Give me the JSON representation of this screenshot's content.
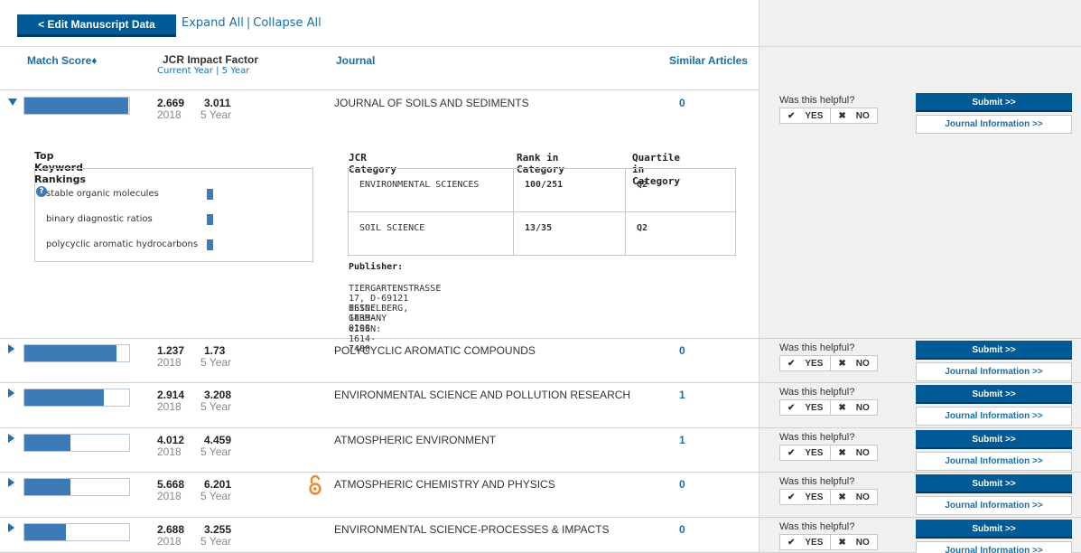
{
  "toolbar": {
    "edit_label": "< Edit Manuscript Data",
    "expand_all": "Expand All",
    "separator": "|",
    "collapse_all": "Collapse All"
  },
  "columns": {
    "match_score": "Match Score♦",
    "jcr_title": "JCR Impact Factor",
    "jcr_current": "Current Year",
    "jcr_sep": "|",
    "jcr_5year": "5 Year",
    "journal": "Journal",
    "similar": "Similar Articles"
  },
  "common": {
    "helpful": "Was this helpful?",
    "yes": "YES",
    "no": "NO",
    "submit": "Submit >>",
    "journal_info": "Journal Information >>",
    "year_label": "2018",
    "five_year_label": "5 Year"
  },
  "journals": [
    {
      "score": 0.99,
      "jif": "2.669",
      "jif5": "3.011",
      "name": "JOURNAL OF SOILS AND SEDIMENTS",
      "similar": "0",
      "expanded": true,
      "open_access": false
    },
    {
      "score": 0.88,
      "jif": "1.237",
      "jif5": "1.73",
      "name": "POLYCYCLIC AROMATIC COMPOUNDS",
      "similar": "0",
      "expanded": false,
      "open_access": false
    },
    {
      "score": 0.76,
      "jif": "2.914",
      "jif5": "3.208",
      "name": "ENVIRONMENTAL SCIENCE AND POLLUTION RESEARCH",
      "similar": "1",
      "expanded": false,
      "open_access": false
    },
    {
      "score": 0.44,
      "jif": "4.012",
      "jif5": "4.459",
      "name": "ATMOSPHERIC ENVIRONMENT",
      "similar": "1",
      "expanded": false,
      "open_access": false
    },
    {
      "score": 0.44,
      "jif": "5.668",
      "jif5": "6.201",
      "name": "ATMOSPHERIC CHEMISTRY AND PHYSICS",
      "similar": "0",
      "expanded": false,
      "open_access": true
    },
    {
      "score": 0.4,
      "jif": "2.688",
      "jif5": "3.255",
      "name": "ENVIRONMENTAL SCIENCE-PROCESSES & IMPACTS",
      "similar": "0",
      "expanded": false,
      "open_access": false
    }
  ],
  "detail": {
    "keyword_title": "Top Keyword Rankings",
    "help_glyph": "?",
    "keywords": [
      "stable organic molecules",
      "binary diagnostic ratios",
      "polycyclic aromatic hydrocarbons"
    ],
    "jcr_category_head": "JCR Category",
    "rank_head": "Rank in Category",
    "quartile_head": "Quartile in Category",
    "categories": [
      {
        "name": "ENVIRONMENTAL SCIENCES",
        "rank": "100/251",
        "quartile": "Q2"
      },
      {
        "name": "SOIL SCIENCE",
        "rank": "13/35",
        "quartile": "Q2"
      }
    ],
    "publisher_label": "Publisher:",
    "publisher_address": "TIERGARTENSTRASSE 17, D-69121 HEIDELBERG, GERMANY",
    "issn": "ISSN: 1439-0108",
    "eissn": "eISSN: 1614-7480"
  },
  "colors": {
    "accent": "#005a96",
    "link": "#1a6fa8",
    "bar": "#3c7ab8",
    "yes": "#6cb33e",
    "no": "#dd2222",
    "open_access": "#f0862a"
  }
}
